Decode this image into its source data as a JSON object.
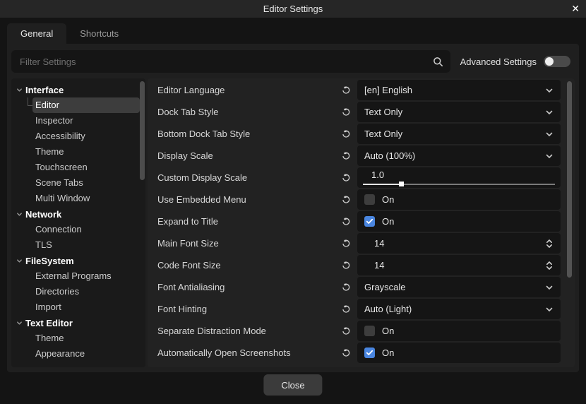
{
  "window": {
    "title": "Editor Settings"
  },
  "icons": {
    "close": "✕"
  },
  "tabs": [
    {
      "label": "General",
      "active": true
    },
    {
      "label": "Shortcuts",
      "active": false
    }
  ],
  "search": {
    "placeholder": "Filter Settings"
  },
  "advanced": {
    "label": "Advanced Settings",
    "enabled": false
  },
  "tree": {
    "sections": [
      {
        "label": "Interface",
        "children": [
          {
            "label": "Editor",
            "selected": true
          },
          {
            "label": "Inspector"
          },
          {
            "label": "Accessibility"
          },
          {
            "label": "Theme"
          },
          {
            "label": "Touchscreen"
          },
          {
            "label": "Scene Tabs"
          },
          {
            "label": "Multi Window"
          }
        ]
      },
      {
        "label": "Network",
        "children": [
          {
            "label": "Connection"
          },
          {
            "label": "TLS"
          }
        ]
      },
      {
        "label": "FileSystem",
        "children": [
          {
            "label": "External Programs"
          },
          {
            "label": "Directories"
          },
          {
            "label": "Import"
          }
        ]
      },
      {
        "label": "Text Editor",
        "children": [
          {
            "label": "Theme"
          },
          {
            "label": "Appearance"
          }
        ]
      }
    ]
  },
  "settings": {
    "rows": [
      {
        "label": "Editor Language",
        "type": "dropdown",
        "value": "[en] English",
        "revert": true
      },
      {
        "label": "Dock Tab Style",
        "type": "dropdown",
        "value": "Text Only"
      },
      {
        "label": "Bottom Dock Tab Style",
        "type": "dropdown",
        "value": "Text Only"
      },
      {
        "label": "Display Scale",
        "type": "dropdown",
        "value": "Auto (100%)"
      },
      {
        "label": "Custom Display Scale",
        "type": "slider",
        "value": "1.0",
        "percent": 20
      },
      {
        "label": "Use Embedded Menu",
        "type": "checkbox",
        "checked": false,
        "value": "On"
      },
      {
        "label": "Expand to Title",
        "type": "checkbox",
        "checked": true,
        "value": "On"
      },
      {
        "label": "Main Font Size",
        "type": "spinner",
        "value": "14"
      },
      {
        "label": "Code Font Size",
        "type": "spinner",
        "value": "14"
      },
      {
        "label": "Font Antialiasing",
        "type": "dropdown",
        "value": "Grayscale"
      },
      {
        "label": "Font Hinting",
        "type": "dropdown",
        "value": "Auto (Light)"
      },
      {
        "label": "Separate Distraction Mode",
        "type": "checkbox",
        "checked": false,
        "value": "On"
      },
      {
        "label": "Automatically Open Screenshots",
        "type": "checkbox",
        "checked": true,
        "value": "On"
      }
    ]
  },
  "footer": {
    "close_label": "Close"
  },
  "colors": {
    "accent": "#4a86e0",
    "titlebar": "#262626",
    "panel": "#1f1f1f",
    "selected_item": "#3d3d3d"
  }
}
